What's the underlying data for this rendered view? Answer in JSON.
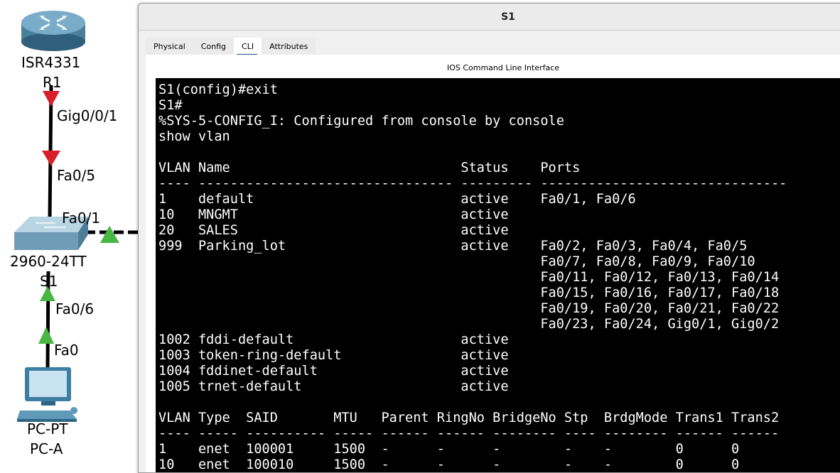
{
  "topology": {
    "router": {
      "model": "ISR4331",
      "name": "R1",
      "port": "Gig0/0/1"
    },
    "switch": {
      "model": "2960-24TT",
      "name": "S1",
      "port_up": "Fa0/5",
      "port_right": "Fa0/1",
      "port_down": "Fa0/6"
    },
    "pc": {
      "model": "PC-PT",
      "name": "PC-A",
      "port": "Fa0"
    },
    "link_colors": {
      "down": "#d9202a",
      "up": "#49b543"
    }
  },
  "window": {
    "title": "S1",
    "tabs": [
      {
        "label": "Physical",
        "active": false
      },
      {
        "label": "Config",
        "active": false
      },
      {
        "label": "CLI",
        "active": true
      },
      {
        "label": "Attributes",
        "active": false
      }
    ],
    "cli_heading": "IOS Command Line Interface"
  },
  "terminal": {
    "lines": [
      "S1(config)#exit",
      "S1#",
      "%SYS-5-CONFIG_I: Configured from console by console",
      "show vlan",
      "",
      "VLAN Name                             Status    Ports",
      "---- -------------------------------- --------- -------------------------------",
      "1    default                          active    Fa0/1, Fa0/6",
      "10   MNGMT                            active",
      "20   SALES                            active",
      "999  Parking_lot                      active    Fa0/2, Fa0/3, Fa0/4, Fa0/5",
      "                                                Fa0/7, Fa0/8, Fa0/9, Fa0/10",
      "                                                Fa0/11, Fa0/12, Fa0/13, Fa0/14",
      "                                                Fa0/15, Fa0/16, Fa0/17, Fa0/18",
      "                                                Fa0/19, Fa0/20, Fa0/21, Fa0/22",
      "                                                Fa0/23, Fa0/24, Gig0/1, Gig0/2",
      "1002 fddi-default                     active",
      "1003 token-ring-default               active",
      "1004 fddinet-default                  active",
      "1005 trnet-default                    active",
      "",
      "VLAN Type  SAID       MTU   Parent RingNo BridgeNo Stp  BrdgMode Trans1 Trans2",
      "---- ----- ---------- ----- ------ ------ -------- ---- -------- ------ ------",
      "1    enet  100001     1500  -      -      -        -    -        0      0",
      "10   enet  100010     1500  -      -      -        -    -        0      0"
    ]
  }
}
